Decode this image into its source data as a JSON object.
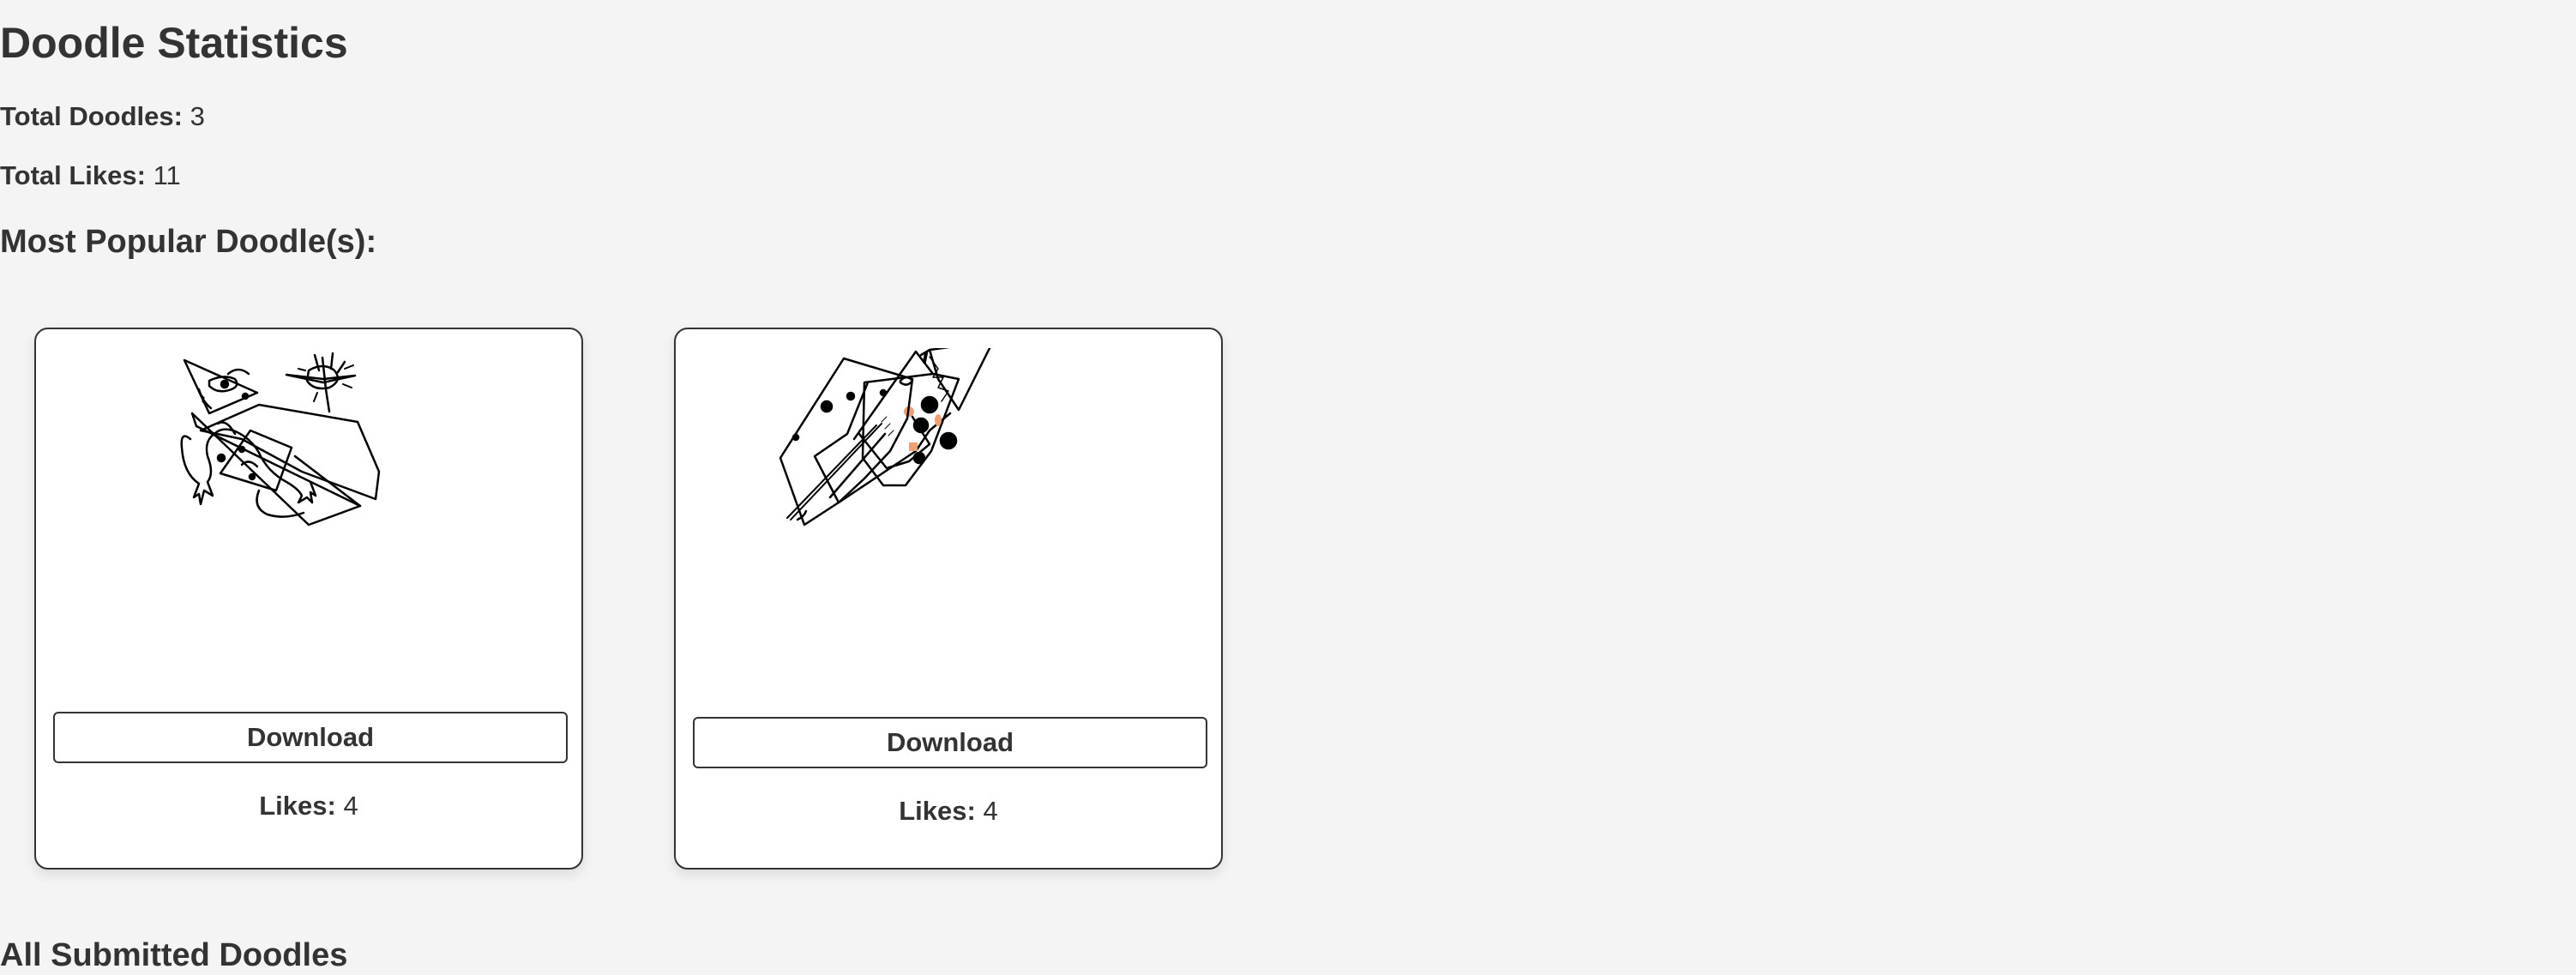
{
  "page": {
    "title": "Doodle Statistics"
  },
  "stats": {
    "total_doodles_label": "Total Doodles:",
    "total_doodles_value": "3",
    "total_likes_label": "Total Likes:",
    "total_likes_value": "11"
  },
  "sections": {
    "most_popular": "Most Popular Doodle(s):",
    "all_submitted": "All Submitted Doodles"
  },
  "popular_doodles": [
    {
      "download_label": "Download",
      "likes_label": "Likes:",
      "likes_value": "4"
    },
    {
      "download_label": "Download",
      "likes_label": "Likes:",
      "likes_value": "4"
    }
  ],
  "colors": {
    "background": "#f4f4f4",
    "text": "#333333",
    "card_background": "#ffffff",
    "doodle_stroke": "#000000",
    "doodle_accent": "#f0a070"
  }
}
